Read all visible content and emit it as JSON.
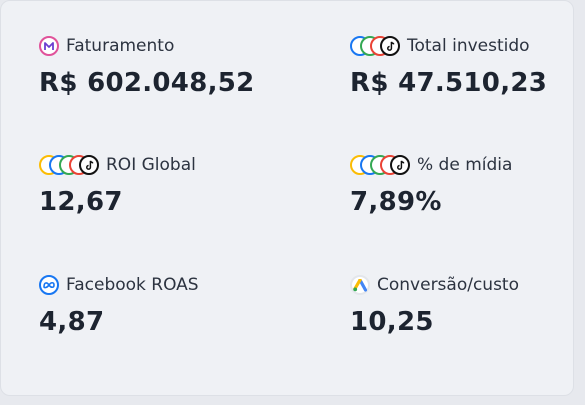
{
  "metrics": [
    {
      "label": "Faturamento",
      "value": "R$ 602.048,52",
      "icon": "brand-m-icon"
    },
    {
      "label": "Total investido",
      "value": "R$ 47.510,23",
      "icon": "channels-stack-icon"
    },
    {
      "label": "ROI Global",
      "value": "12,67",
      "icon": "channels-stack-icon"
    },
    {
      "label": "% de mídia",
      "value": "7,89%",
      "icon": "channels-stack-icon"
    },
    {
      "label": "Facebook ROAS",
      "value": "4,87",
      "icon": "meta-icon"
    },
    {
      "label": "Conversão/custo",
      "value": "10,25",
      "icon": "google-ads-icon"
    }
  ],
  "colors": {
    "meta_blue": "#1877f2",
    "google_blue": "#4285f4",
    "google_yellow": "#fbbc04",
    "google_green": "#34a853",
    "google_red": "#ea4335",
    "tiktok_black": "#111111"
  }
}
